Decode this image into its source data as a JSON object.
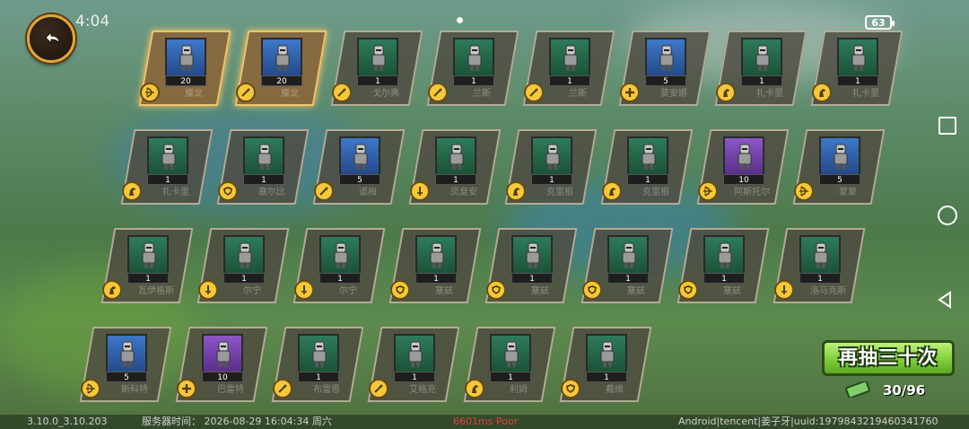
{
  "status": {
    "time": "4:04",
    "battery": "63"
  },
  "cards": [
    {
      "count": "20",
      "name": "魔龙",
      "cls": "bow",
      "color": "blue",
      "gold": true
    },
    {
      "count": "20",
      "name": "魔龙",
      "cls": "spear",
      "color": "blue",
      "gold": true
    },
    {
      "count": "1",
      "name": "戈尔弗",
      "cls": "spear",
      "color": "green"
    },
    {
      "count": "1",
      "name": "兰斯",
      "cls": "spear",
      "color": "green"
    },
    {
      "count": "1",
      "name": "兰斯",
      "cls": "spear",
      "color": "green"
    },
    {
      "count": "5",
      "name": "莫安娜",
      "cls": "plus",
      "color": "blue"
    },
    {
      "count": "1",
      "name": "扎卡里",
      "cls": "horse",
      "color": "green"
    },
    {
      "count": "1",
      "name": "扎卡里",
      "cls": "horse",
      "color": "green"
    },
    {
      "count": "1",
      "name": "扎卡里",
      "cls": "horse",
      "color": "green"
    },
    {
      "count": "1",
      "name": "塞尔比",
      "cls": "shield",
      "color": "green"
    },
    {
      "count": "5",
      "name": "道梅",
      "cls": "spear",
      "color": "blue"
    },
    {
      "count": "1",
      "name": "凤皇安",
      "cls": "sword",
      "color": "green"
    },
    {
      "count": "1",
      "name": "克里根",
      "cls": "horse",
      "color": "green"
    },
    {
      "count": "1",
      "name": "克里根",
      "cls": "horse",
      "color": "green"
    },
    {
      "count": "10",
      "name": "阿斯托尔",
      "cls": "bow",
      "color": "purple"
    },
    {
      "count": "5",
      "name": "蒙蒙",
      "cls": "bow",
      "color": "blue"
    },
    {
      "count": "1",
      "name": "瓦伊格斯",
      "cls": "horse",
      "color": "green"
    },
    {
      "count": "1",
      "name": "尔宁",
      "cls": "sword",
      "color": "green"
    },
    {
      "count": "1",
      "name": "尔宁",
      "cls": "sword",
      "color": "green"
    },
    {
      "count": "1",
      "name": "塞兹",
      "cls": "shield",
      "color": "green"
    },
    {
      "count": "1",
      "name": "塞兹",
      "cls": "shield",
      "color": "green"
    },
    {
      "count": "1",
      "name": "塞兹",
      "cls": "shield",
      "color": "green"
    },
    {
      "count": "1",
      "name": "塞兹",
      "cls": "shield",
      "color": "green"
    },
    {
      "count": "1",
      "name": "洛马克斯",
      "cls": "sword",
      "color": "green"
    },
    {
      "count": "5",
      "name": "斯科特",
      "cls": "bow",
      "color": "blue"
    },
    {
      "count": "10",
      "name": "巴雷特",
      "cls": "plus",
      "color": "purple"
    },
    {
      "count": "1",
      "name": "布雷恩",
      "cls": "spear",
      "color": "green"
    },
    {
      "count": "1",
      "name": "艾格克",
      "cls": "spear",
      "color": "green"
    },
    {
      "count": "1",
      "name": "利姆",
      "cls": "horse",
      "color": "green"
    },
    {
      "count": "1",
      "name": "戴维",
      "cls": "shield",
      "color": "green"
    }
  ],
  "draw_button": "再抽三十次",
  "draw_count": "30/96",
  "footer": {
    "version": "3.10.0_3.10.203",
    "server_time": "服务器时间：  2026-08-29  16:04:34  周六",
    "ping": "6601ms Poor",
    "device": "Android|tencent|姜子牙|uuid:1979843219460341760"
  }
}
